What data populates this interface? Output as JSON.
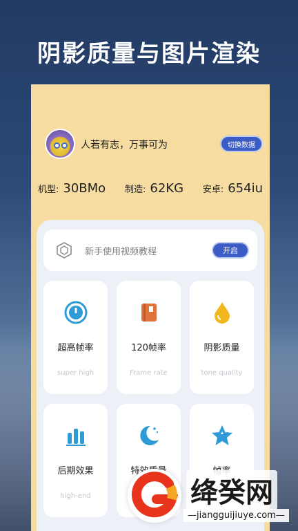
{
  "headline": "阴影质量与图片渲染",
  "profile": {
    "name": "人若有志，万事可为",
    "switch_label": "切换数据"
  },
  "specs": [
    {
      "label": "机型:",
      "value": "30BMo"
    },
    {
      "label": "制造:",
      "value": "62KG"
    },
    {
      "label": "安卓:",
      "value": "654iu"
    }
  ],
  "tutorial": {
    "text": "新手使用视频教程",
    "button_label": "开启"
  },
  "tiles": [
    {
      "title": "超高帧率",
      "sub": "super high",
      "icon": "timer-icon"
    },
    {
      "title": "120帧率",
      "sub": "Frame rate",
      "icon": "book-icon"
    },
    {
      "title": "阴影质量",
      "sub": "tone quality",
      "icon": "droplet-icon"
    },
    {
      "title": "后期效果",
      "sub": "high-end",
      "icon": "bar-chart-icon"
    },
    {
      "title": "特效质量",
      "sub": "",
      "icon": "moon-icon"
    },
    {
      "title": "帧率",
      "sub": "",
      "icon": "star-icon"
    }
  ],
  "watermark": {
    "brand": "绛癸网",
    "url": "—jiangguijiuye.com—"
  },
  "colors": {
    "accent": "#3a5cc4",
    "card_bg": "#f7dca2",
    "panel_bg": "#eef0f8",
    "icon_blue": "#2f9bd6",
    "icon_orange": "#e0733a",
    "icon_yellow": "#f0b81e"
  }
}
